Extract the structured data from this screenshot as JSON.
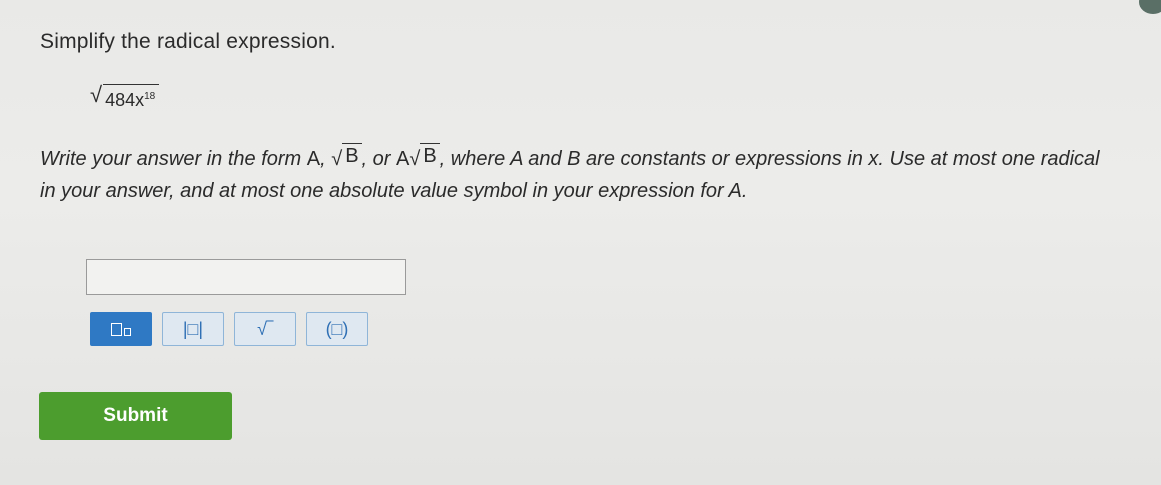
{
  "question": {
    "title": "Simplify the radical expression.",
    "expression_radicand": "484x",
    "expression_exponent": "18",
    "instructions_part1": "Write your answer in the form ",
    "form_A": "A",
    "form_sep1": ", ",
    "form_B1": "B",
    "form_sep2": ", or ",
    "form_A2": "A",
    "form_B2": "B",
    "instructions_part2": ", where A and B are constants or expressions in x. Use at most one radical in your answer, and at most one absolute value symbol in your expression for A."
  },
  "answer": {
    "value": ""
  },
  "toolbar": {
    "buttons": [
      {
        "name": "exponent-button",
        "icon": "superscript-icon"
      },
      {
        "name": "absolute-value-button",
        "label": "|□|"
      },
      {
        "name": "square-root-button",
        "label": "√‾"
      },
      {
        "name": "parentheses-button",
        "label": "(□)"
      }
    ],
    "abs_label": "|□|",
    "sqrt_label": "√‾",
    "paren_label": "(□)"
  },
  "submit": {
    "label": "Submit",
    "color": "#4c9d2e"
  },
  "colors": {
    "accent": "#2f79c4",
    "toolbar_bg": "#dfe8f1"
  }
}
